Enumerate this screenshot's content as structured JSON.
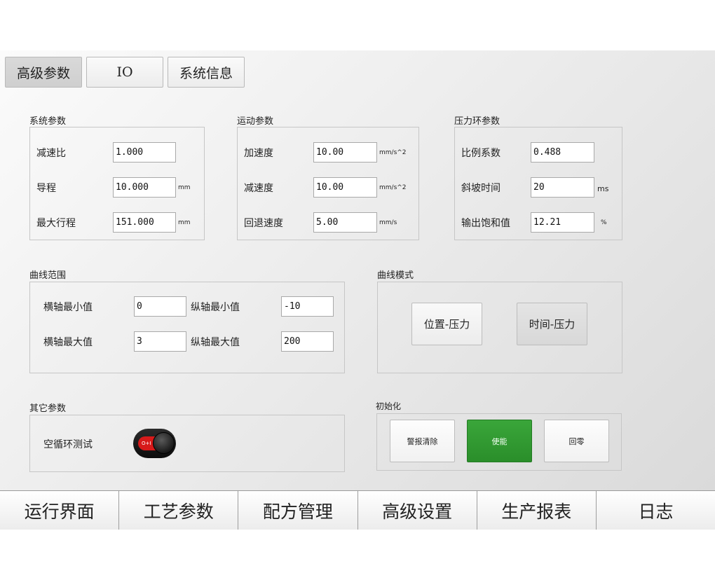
{
  "top_tabs": {
    "advanced_params": "高级参数",
    "io": "IO",
    "system_info": "系统信息"
  },
  "system_params": {
    "title": "系统参数",
    "reduction_ratio": {
      "label": "减速比",
      "value": "1.000"
    },
    "lead": {
      "label": "导程",
      "value": "10.000",
      "unit": "mm"
    },
    "max_stroke": {
      "label": "最大行程",
      "value": "151.000",
      "unit": "mm"
    }
  },
  "motion_params": {
    "title": "运动参数",
    "acceleration": {
      "label": "加速度",
      "value": "10.00",
      "unit": "mm/s^2"
    },
    "deceleration": {
      "label": "减速度",
      "value": "10.00",
      "unit": "mm/s^2"
    },
    "retract_speed": {
      "label": "回退速度",
      "value": "5.00",
      "unit": "mm/s"
    }
  },
  "pressure_loop": {
    "title": "压力环参数",
    "proportional": {
      "label": "比例系数",
      "value": "0.488"
    },
    "ramp_time": {
      "label": "斜坡时间",
      "value": "20",
      "unit": "ms"
    },
    "output_saturation": {
      "label": "输出饱和值",
      "value": "12.21",
      "unit": "%"
    }
  },
  "curve_range": {
    "title": "曲线范围",
    "x_min": {
      "label": "横轴最小值",
      "value": "0"
    },
    "y_min": {
      "label": "纵轴最小值",
      "value": "-10"
    },
    "x_max": {
      "label": "横轴最大值",
      "value": "3"
    },
    "y_max": {
      "label": "纵轴最大值",
      "value": "200"
    }
  },
  "curve_mode": {
    "title": "曲线模式",
    "position_pressure": "位置-压力",
    "time_pressure": "时间-压力"
  },
  "other_params": {
    "title": "其它参数",
    "dry_cycle_test": "空循环测试",
    "toggle_text": "O+I"
  },
  "initialization": {
    "title": "初始化",
    "clear_alarm": "警报清除",
    "enable": "使能",
    "home": "回零"
  },
  "colors": {
    "enable_green": "#2e9a2e",
    "toggle_red": "#d71a1a"
  },
  "bottom_nav": [
    "运行界面",
    "工艺参数",
    "配方管理",
    "高级设置",
    "生产报表",
    "日志"
  ]
}
